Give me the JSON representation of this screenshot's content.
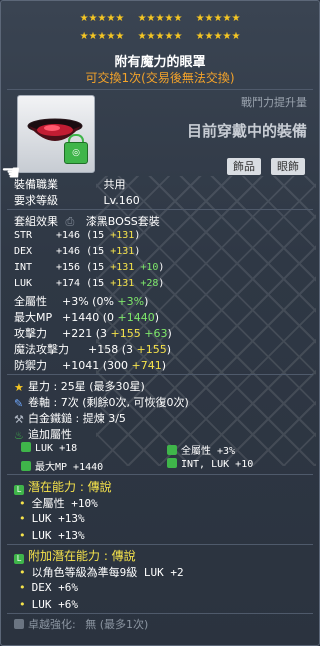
{
  "star_force": {
    "row1_groups": [
      "★★★★★",
      "★★★★★",
      "★★★★★"
    ],
    "row2_groups": [
      "★★★★★",
      "★★★★★",
      "★★★★★"
    ]
  },
  "item": {
    "name": "附有魔力的眼罩",
    "trade_note": "可交換1次(交易後無法交換)",
    "icon_name": "eye-patch-icon",
    "lock_icon": "green-lock-icon"
  },
  "panel": {
    "combat_label": "戰鬥力提升量",
    "equipped_label": "目前穿戴中的裝備",
    "tags": [
      "飾品",
      "眼飾"
    ]
  },
  "requirements": {
    "job_label": "裝備職業",
    "job_value": "共用",
    "level_label": "要求等級",
    "level_value": "Lv.160"
  },
  "set": {
    "label": "套組效果",
    "value": "漆黑BOSS套裝"
  },
  "stats": [
    {
      "name": "STR",
      "total": "+146",
      "base": "(15",
      "bonus1": "+131",
      "bonus2": "",
      "close": ")"
    },
    {
      "name": "DEX",
      "total": "+146",
      "base": "(15",
      "bonus1": "+131",
      "bonus2": "",
      "close": ")"
    },
    {
      "name": "INT",
      "total": "+156",
      "base": "(15",
      "bonus1": "+131",
      "bonus2": "+10",
      "close": ")"
    },
    {
      "name": "LUK",
      "total": "+174",
      "base": "(15",
      "bonus1": "+131",
      "bonus2": "+28",
      "close": ")"
    },
    {
      "name": "全屬性",
      "total": "+3%",
      "base": "(0%",
      "bonus1": "",
      "bonus2": "+3%",
      "close": ")"
    },
    {
      "name": "最大MP",
      "total": "+1440",
      "base": "(0",
      "bonus1": "",
      "bonus2": "+1440",
      "close": ")"
    },
    {
      "name": "攻擊力",
      "total": "+221",
      "base": "(3",
      "bonus1": "+155",
      "bonus2": "+63",
      "close": ")"
    },
    {
      "name": "魔法攻擊力",
      "total": "+158",
      "base": "(3",
      "bonus1": "+155",
      "bonus2": "",
      "close": ")"
    },
    {
      "name": "防禦力",
      "total": "+1041",
      "base": "(300",
      "bonus1": "",
      "bonus2": "",
      "bonus3": "+741",
      "close": ")"
    }
  ],
  "upgrades": {
    "star_label": "星力",
    "star_value": ": 25星 (最多30星)",
    "scroll_label": "卷軸",
    "scroll_value": ": 7次 (剩餘0次, 可恢復0次)",
    "hammer_label": "白金鐵鎚",
    "hammer_value": ": 提煉 3/5"
  },
  "flame": {
    "header": "追加屬性",
    "items": [
      "LUK  +18",
      "全屬性  +3%",
      "最大MP  +1440",
      "INT, LUK  +10"
    ]
  },
  "potential": {
    "badge": "L",
    "header": "潛在能力 : 傳說",
    "lines": [
      "全屬性  +10%",
      "LUK  +13%",
      "LUK  +13%"
    ]
  },
  "bonus_potential": {
    "badge": "L",
    "header": "附加潛在能力 : 傳說",
    "lines": [
      "以角色等級為準每9級 LUK +2",
      "DEX  +6%",
      "LUK  +6%"
    ]
  },
  "exceptional": {
    "label": "卓越強化:",
    "value": "無 (最多1次)"
  },
  "colors": {
    "stars": "#f5c623",
    "trade_note": "#f4a32a",
    "scroll_bonus": "#f6e34b",
    "potential_bonus": "#7ee86a",
    "legendary": "#3fb54a"
  }
}
